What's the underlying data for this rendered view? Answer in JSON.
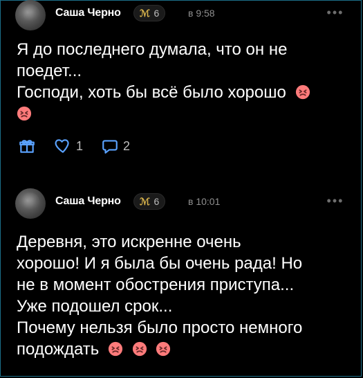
{
  "posts": [
    {
      "author": "Саша Черно",
      "badge_level": "6",
      "time": "в 9:58",
      "lines": [
        "Я до последнего думала, что он не",
        "поедет...",
        "Господи, хоть бы всё было хорошо"
      ],
      "likes": "1",
      "comments": "2"
    },
    {
      "author": "Саша Черно",
      "badge_level": "6",
      "time": "в 10:01",
      "lines": [
        "Деревня, это искренне очень",
        "хорошо! И я была бы очень рада! Но",
        "не в момент обострения приступа...",
        "Уже подошел срок...",
        "Почему нельзя было просто немного",
        "подождать"
      ]
    }
  ],
  "icons": {
    "gift": "gift-icon",
    "like": "heart-outline-icon",
    "comment": "comment-icon",
    "more": "more-horizontal-icon",
    "badge": "level-badge-icon",
    "emoji": "confounded-face-emoji"
  },
  "colors": {
    "background": "#000000",
    "accent": "#5aa2ff",
    "emoji": "#ff7b7b"
  }
}
